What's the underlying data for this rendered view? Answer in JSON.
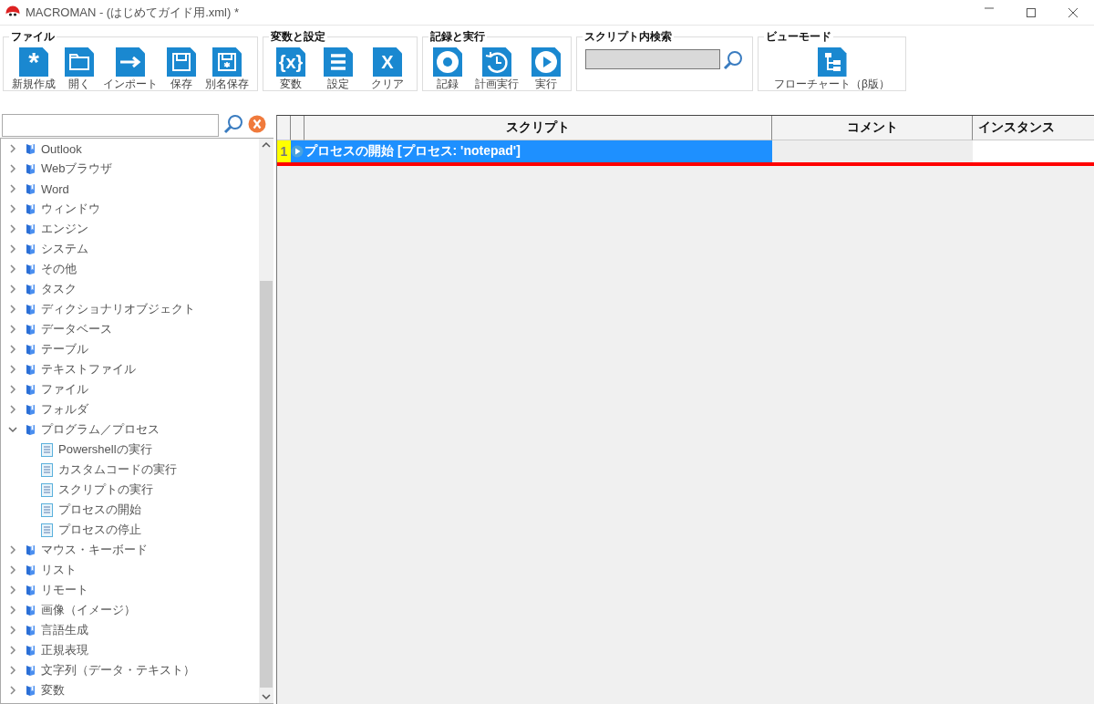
{
  "window": {
    "title": "MACROMAN - (はじめてガイド用.xml) *"
  },
  "ribbon": {
    "groups": [
      {
        "title": "ファイル",
        "kind": "buttons",
        "buttons": [
          {
            "label": "新規作成",
            "kind": "new",
            "icon_text": "*"
          },
          {
            "label": "開く",
            "kind": "open"
          },
          {
            "label": "インポート",
            "kind": "import"
          },
          {
            "label": "保存",
            "kind": "save"
          },
          {
            "label": "別名保存",
            "kind": "saveas"
          }
        ]
      },
      {
        "title": "変数と設定",
        "kind": "buttons",
        "buttons": [
          {
            "label": "変数",
            "kind": "glyph",
            "icon_text": "{x}"
          },
          {
            "label": "設定",
            "kind": "settings"
          },
          {
            "label": "クリア",
            "kind": "glyph",
            "icon_text": "X"
          }
        ]
      },
      {
        "title": "記録と実行",
        "kind": "buttons",
        "buttons": [
          {
            "label": "記録",
            "kind": "record"
          },
          {
            "label": "計画実行",
            "kind": "schedule"
          },
          {
            "label": "実行",
            "kind": "run"
          }
        ]
      },
      {
        "title": "スクリプト内検索",
        "kind": "search"
      },
      {
        "title": "ビューモード",
        "kind": "buttons",
        "buttons": [
          {
            "label": "フローチャート（β版）",
            "kind": "flowchart"
          }
        ]
      }
    ]
  },
  "tree": {
    "items": [
      {
        "label": "Outlook",
        "expanded": false
      },
      {
        "label": "Webブラウザ",
        "expanded": false
      },
      {
        "label": "Word",
        "expanded": false
      },
      {
        "label": "ウィンドウ",
        "expanded": false
      },
      {
        "label": "エンジン",
        "expanded": false
      },
      {
        "label": "システム",
        "expanded": false
      },
      {
        "label": "その他",
        "expanded": false
      },
      {
        "label": "タスク",
        "expanded": false
      },
      {
        "label": "ディクショナリオブジェクト",
        "expanded": false
      },
      {
        "label": "データベース",
        "expanded": false
      },
      {
        "label": "テーブル",
        "expanded": false
      },
      {
        "label": "テキストファイル",
        "expanded": false
      },
      {
        "label": "ファイル",
        "expanded": false
      },
      {
        "label": "フォルダ",
        "expanded": false
      },
      {
        "label": "プログラム／プロセス",
        "expanded": true,
        "children": [
          {
            "label": "Powershellの実行"
          },
          {
            "label": "カスタムコードの実行"
          },
          {
            "label": "スクリプトの実行"
          },
          {
            "label": "プロセスの開始"
          },
          {
            "label": "プロセスの停止"
          }
        ]
      },
      {
        "label": "マウス・キーボード",
        "expanded": false
      },
      {
        "label": "リスト",
        "expanded": false
      },
      {
        "label": "リモート",
        "expanded": false
      },
      {
        "label": "画像（イメージ）",
        "expanded": false
      },
      {
        "label": "言語生成",
        "expanded": false
      },
      {
        "label": "正規表現",
        "expanded": false
      },
      {
        "label": "文字列（データ・テキスト）",
        "expanded": false
      },
      {
        "label": "変数",
        "expanded": false
      }
    ]
  },
  "grid": {
    "columns": [
      "スクリプト",
      "コメント",
      "インスタンス"
    ],
    "rows": [
      {
        "number": "1",
        "script": "プロセスの開始 [プロセス: 'notepad']",
        "selected": true
      }
    ]
  }
}
